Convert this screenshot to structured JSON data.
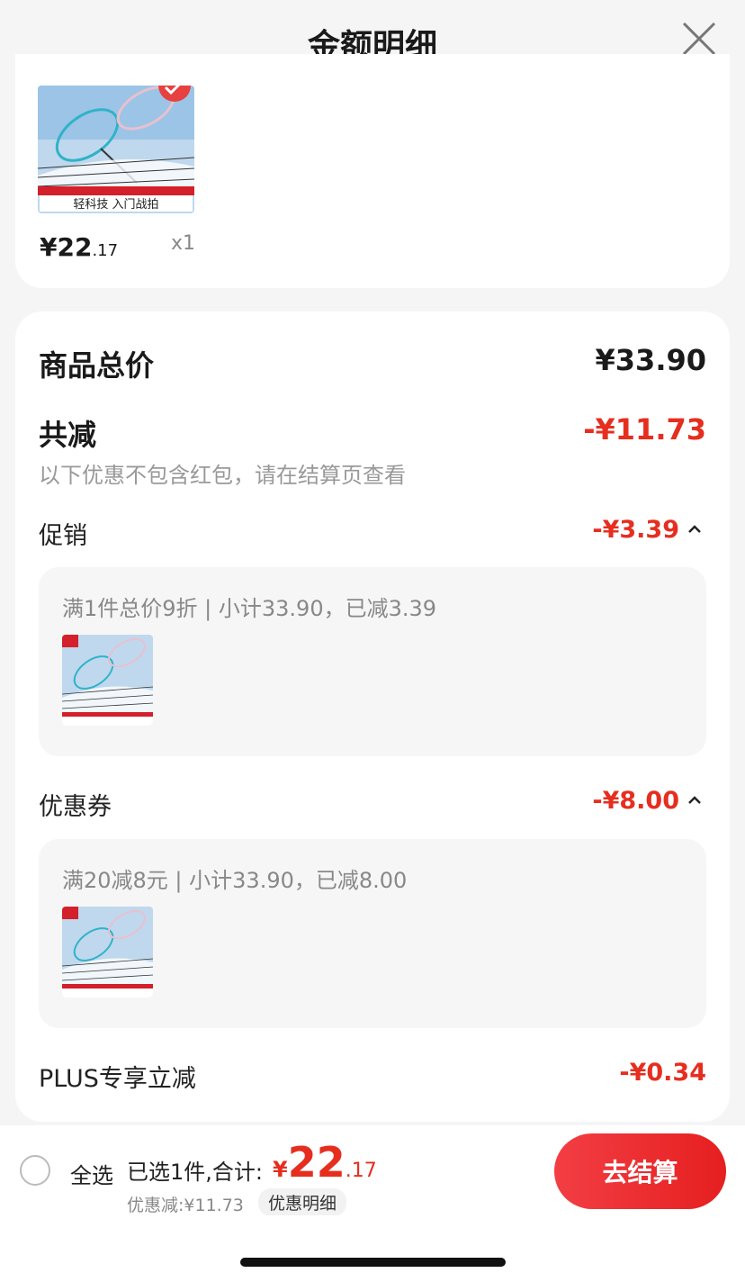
{
  "header": {
    "title": "金额明细"
  },
  "product": {
    "image_caption": "轻科技 入门战拍",
    "price_main": "¥22",
    "price_decimal": ".17",
    "quantity": "x1"
  },
  "summary": {
    "total_label": "商品总价",
    "total_value": "¥33.90",
    "reduce_label": "共减",
    "reduce_value": "-¥11.73",
    "reduce_note": "以下优惠不包含红包，请在结算页查看"
  },
  "promotion": {
    "label": "促销",
    "value": "-¥3.39",
    "detail": "满1件总价9折 | 小计33.90，已减3.39"
  },
  "coupon": {
    "label": "优惠券",
    "value": "-¥8.00",
    "detail": "满20减8元 | 小计33.90，已减8.00"
  },
  "plus": {
    "label": "PLUS专享立减",
    "value": "-¥0.34"
  },
  "bottom_bar": {
    "select_all": "全选",
    "selected": "已选1件,合计:",
    "total_currency": "¥",
    "total_int": "22",
    "total_dec": ".17",
    "discount": "优惠减:¥11.73",
    "detail_link": "优惠明细",
    "checkout": "去结算"
  },
  "colors": {
    "accent_red": "#e62e1f",
    "background": "#f5f5f5"
  }
}
